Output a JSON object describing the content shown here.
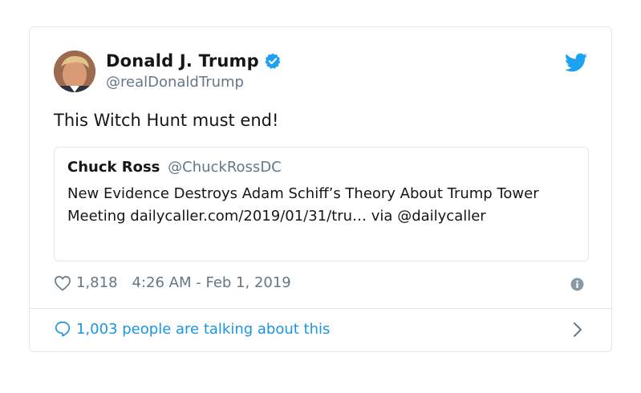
{
  "tweet": {
    "author": {
      "name": "Donald J. Trump",
      "handle": "@realDonaldTrump",
      "verified": true
    },
    "text": "This Witch Hunt must end!",
    "quoted": {
      "name": "Chuck Ross",
      "handle": "@ChuckRossDC",
      "text": "New Evidence Destroys Adam Schiff’s Theory About Trump Tower Meeting dailycaller.com/2019/01/31/tru… via @dailycaller"
    },
    "likes": "1,818",
    "timestamp": "4:26 AM - Feb 1, 2019",
    "talking": "1,003 people are talking about this"
  },
  "icons": {
    "verified": "verified-badge-icon",
    "brand": "twitter-bird-icon",
    "like": "heart-icon",
    "info": "info-icon",
    "reply": "speech-bubble-icon",
    "more": "chevron-right-icon"
  },
  "colors": {
    "brand": "#1da1f2",
    "link": "#1b95e0",
    "muted": "#657786",
    "border": "#e1e8ed"
  }
}
